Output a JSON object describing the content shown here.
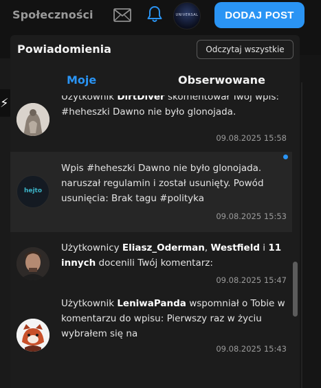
{
  "nav": {
    "community_label": "Społeczności",
    "mail_icon": "mail-icon",
    "bell_icon": "bell-icon",
    "avatar_text": "UNIVERSAL",
    "add_post_label": "DODAJ POST"
  },
  "colors": {
    "accent": "#2a94f4",
    "panel": "#1c1c1c",
    "unread_bg": "#262626",
    "background": "#121212"
  },
  "panel": {
    "title": "Powiadomienia",
    "read_all_label": "Odczytaj wszystkie",
    "tabs": [
      {
        "label": "Moje",
        "active": true
      },
      {
        "label": "Obserwowane",
        "active": false
      }
    ]
  },
  "notifications": [
    {
      "avatar": "sculpture-avatar",
      "parts": [
        "Użytkownik ",
        "DirtDiver",
        " skomentował Twój wpis: #heheszki Dawno nie było glonojada."
      ],
      "date": "09.08.2025 15:58",
      "unread": false
    },
    {
      "avatar": "hejto-logo-avatar",
      "avatar_text": "hejto",
      "parts": [
        "Wpis #heheszki Dawno nie było glonojada. naruszał regulamin i został usunięty. Powód usunięcia: Brak tagu #polityka"
      ],
      "date": "09.08.2025 15:53",
      "unread": true
    },
    {
      "avatar": "man-portrait-avatar",
      "parts": [
        "Użytkownicy ",
        "Eliasz_Oderman",
        ", ",
        "Westfield",
        " i ",
        "11 innych",
        " docenili Twój komentarz:"
      ],
      "date": "09.08.2025 15:47",
      "unread": false
    },
    {
      "avatar": "red-panda-avatar",
      "parts": [
        "Użytkownik ",
        "LeniwaPanda",
        " wspomniał o Tobie w komentarzu do wpisu: Pierwszy raz w życiu wybrałem się na"
      ],
      "date": "09.08.2025 15:43",
      "unread": false
    }
  ]
}
